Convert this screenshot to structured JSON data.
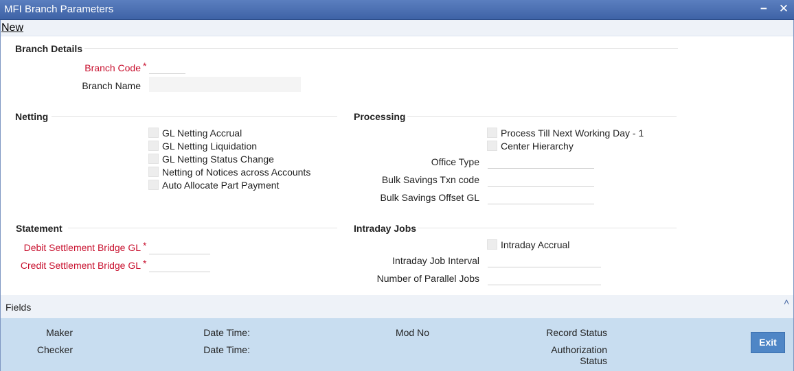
{
  "window": {
    "title": "MFI Branch Parameters",
    "minimize_label": "−",
    "close_label": "✕"
  },
  "toolbar": {
    "new_label": "New"
  },
  "branch_details": {
    "section_title": "Branch Details",
    "branch_code_label": "Branch Code",
    "branch_code_value": "",
    "branch_name_label": "Branch Name",
    "branch_name_value": ""
  },
  "netting": {
    "section_title": "Netting",
    "options": [
      {
        "label": "GL Netting Accrual",
        "checked": false
      },
      {
        "label": "GL Netting Liquidation",
        "checked": false
      },
      {
        "label": "GL Netting Status Change",
        "checked": false
      },
      {
        "label": "Netting of Notices across Accounts",
        "checked": false
      },
      {
        "label": "Auto Allocate Part Payment",
        "checked": false
      }
    ]
  },
  "processing": {
    "section_title": "Processing",
    "process_till_label": "Process Till Next Working Day - 1",
    "center_hierarchy_label": "Center Hierarchy",
    "office_type_label": "Office Type",
    "office_type_value": "",
    "bulk_savings_txn_label": "Bulk Savings Txn code",
    "bulk_savings_txn_value": "",
    "bulk_savings_offset_label": "Bulk Savings Offset GL",
    "bulk_savings_offset_value": ""
  },
  "statement": {
    "section_title": "Statement",
    "debit_label": "Debit Settlement Bridge GL",
    "debit_value": "",
    "credit_label": "Credit Settlement Bridge GL",
    "credit_value": ""
  },
  "intraday": {
    "section_title": "Intraday Jobs",
    "accrual_label": "Intraday Accrual",
    "interval_label": "Intraday Job Interval",
    "interval_value": "",
    "parallel_label": "Number of Parallel Jobs",
    "parallel_value": ""
  },
  "fields_bar": {
    "label": "Fields",
    "caret": "˄"
  },
  "audit": {
    "maker_label": "Maker",
    "checker_label": "Checker",
    "date_time_label_1": "Date Time:",
    "date_time_label_2": "Date Time:",
    "mod_no_label": "Mod No",
    "record_status_label": "Record Status",
    "authorization_label_line1": "Authorization",
    "authorization_label_line2": "Status",
    "exit_label": "Exit"
  },
  "required_marker": "*",
  "colors": {
    "title_bar": "#3e63a6",
    "required": "#c8102e",
    "audit_bg": "#c8ddf0",
    "exit_button": "#4f86c6"
  },
  "icons": {
    "minimize": "minimize-icon",
    "close": "close-icon",
    "expand": "chevron-up-icon"
  }
}
